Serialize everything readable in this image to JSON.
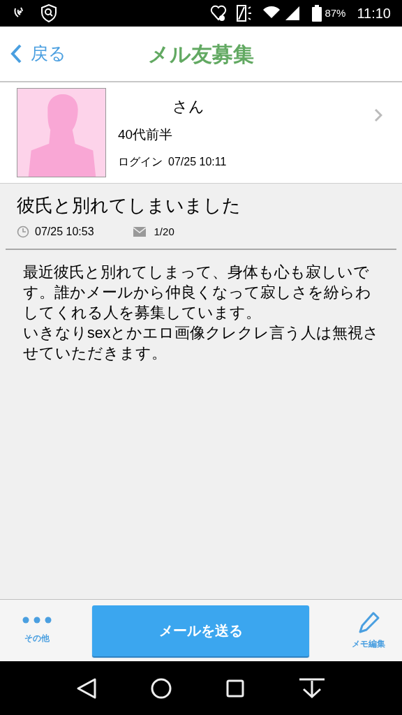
{
  "status_bar": {
    "battery": "87%",
    "time": "11:10"
  },
  "header": {
    "back": "戻る",
    "title": "メル友募集"
  },
  "profile": {
    "name": "さん",
    "age": "40代前半",
    "login_label": "ログイン",
    "login_time": "07/25 10:11"
  },
  "post": {
    "title": "彼氏と別れてしまいました",
    "posted": "07/25 10:53",
    "mail_count": "1/20",
    "body": [
      "最近彼氏と別れてしまって、身体も心も寂しいです。誰かメールから仲良くなって寂しさを紛らわしてくれる人を募集しています。",
      "いきなりsexとかエロ画像クレクレ言う人は無視させていただきます。"
    ]
  },
  "bottom_bar": {
    "more": "その他",
    "send": "メールを送る",
    "memo": "メモ編集"
  }
}
